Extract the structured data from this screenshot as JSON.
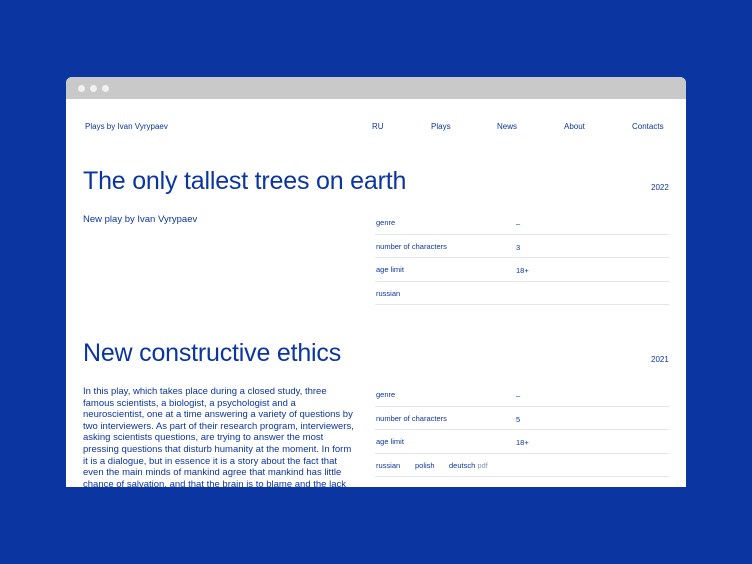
{
  "nav": {
    "brand": "Plays by Ivan Vyrypaev",
    "items": [
      "RU",
      "Plays",
      "News",
      "About",
      "Contacts"
    ]
  },
  "plays": [
    {
      "title": "The only tallest trees on earth",
      "year": "2022",
      "subtitle": "New play by Ivan Vyrypaev",
      "specs": [
        {
          "label": "genre",
          "value": "–"
        },
        {
          "label": "number of characters",
          "value": "3"
        },
        {
          "label": "age limit",
          "value": "18+"
        }
      ],
      "languages": [
        "russian"
      ]
    },
    {
      "title": "New constructive ethics",
      "year": "2021",
      "description": "In this play, which takes place during a closed study, three famous scientists, a biologist, a psychologist and a neuroscientist, one at a time answering a variety of questions by two interviewers. As part of their research program, interviewers, asking scientists questions, are trying to answer the most pressing questions that disturb humanity at the moment. In form it is a dialogue, but in essence it is a story about the fact that even the main minds of mankind agree that mankind has little chance of salvation, and that the brain is to blame and the lack of",
      "specs": [
        {
          "label": "genre",
          "value": "–"
        },
        {
          "label": "number of characters",
          "value": "5"
        },
        {
          "label": "age limit",
          "value": "18+"
        }
      ],
      "languages": [
        "russian",
        "polish",
        "deutsch"
      ],
      "pdf_label": "pdf"
    }
  ],
  "colors": {
    "brand": "#0b35a0",
    "background": "#ffffff",
    "titlebar": "#c9c9c9"
  }
}
